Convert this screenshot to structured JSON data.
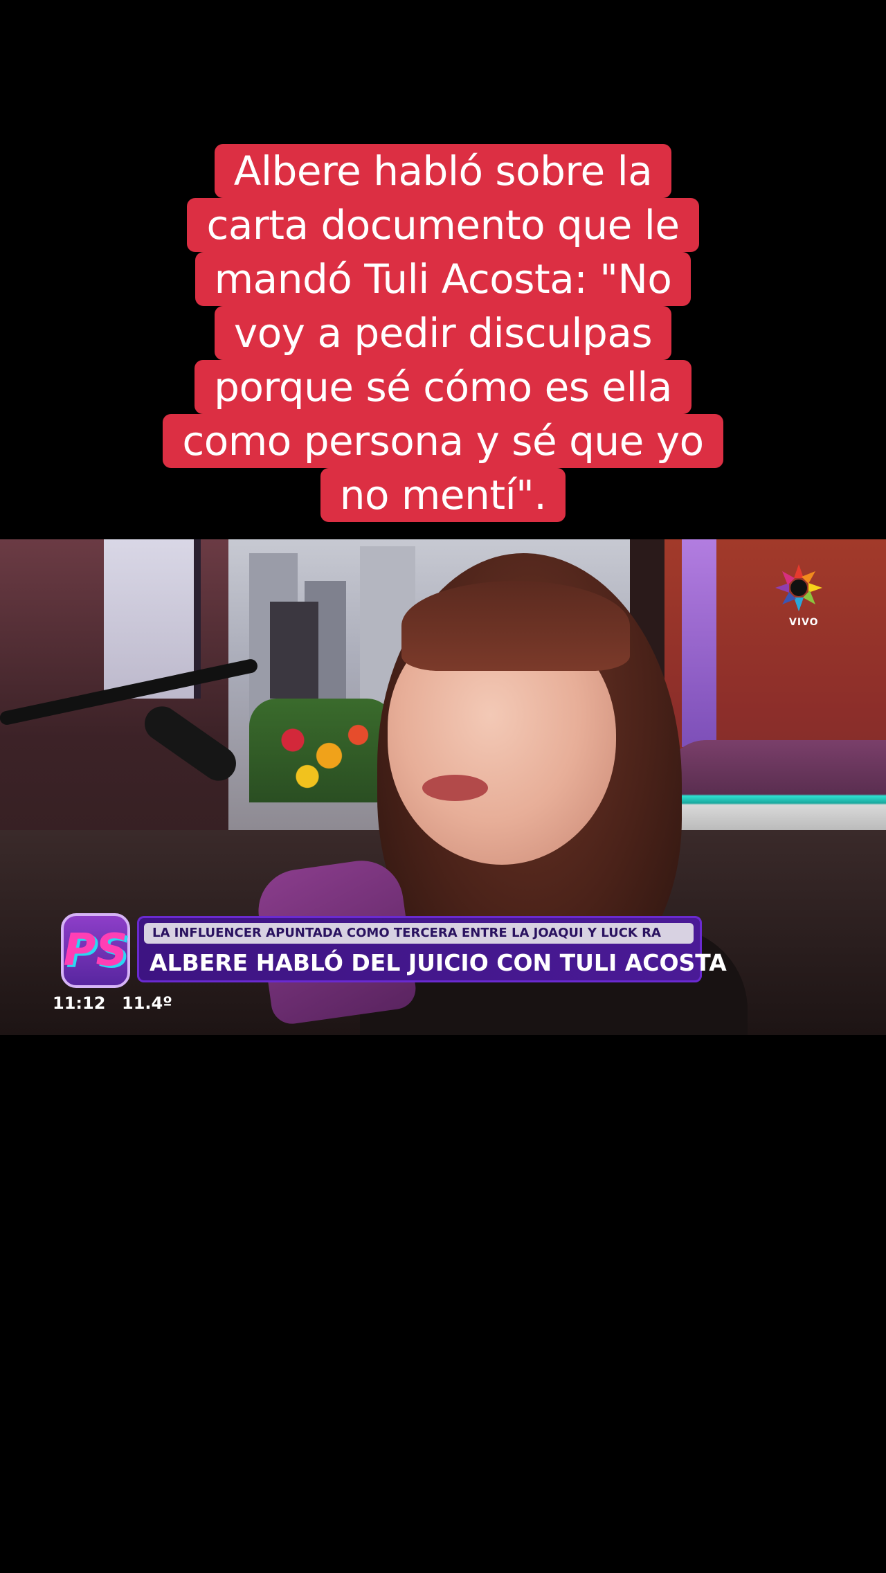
{
  "caption": {
    "lines": [
      "Albere habló sobre la",
      "carta documento que le",
      "mandó Tuli Acosta: \"No",
      "voy a pedir disculpas",
      "porque sé cómo es ella",
      "como persona y sé que yo",
      "no mentí\"."
    ]
  },
  "video": {
    "channel_live_label": "VIVO",
    "lower_third": {
      "kicker": "LA INFLUENCER APUNTADA COMO TERCERA ENTRE LA JOAQUI Y LUCK RA",
      "headline": "ALBERE HABLÓ DEL JUICIO CON TULI ACOSTA"
    },
    "show_logo_text": "PS",
    "clock": "11:12",
    "temperature": "11.4º"
  },
  "colors": {
    "caption_bg": "#dc2f43",
    "lower_third_bg": "#3d1482",
    "background": "#000000"
  }
}
